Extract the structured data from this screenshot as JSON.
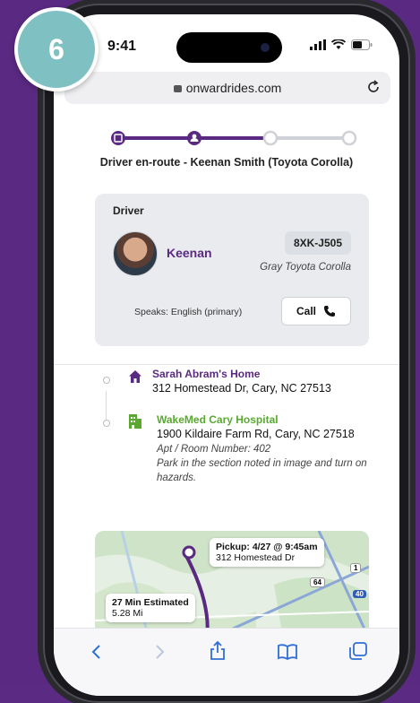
{
  "status_bar": {
    "time": "9:41"
  },
  "browser": {
    "url": "onwardrides.com"
  },
  "step_badge": {
    "number": "6"
  },
  "progress": {
    "steps": 4,
    "completed": 2
  },
  "status_text": "Driver en-route - Keenan Smith (Toyota Corolla)",
  "driver_card": {
    "title": "Driver",
    "name": "Keenan",
    "plate": "8XK-J505",
    "car": "Gray Toyota Corolla",
    "speaks": "Speaks: English (primary)",
    "call_label": "Call"
  },
  "pickup": {
    "name": "Sarah Abram's Home",
    "address": "312 Homestead Dr, Cary, NC 27513"
  },
  "dropoff": {
    "name": "WakeMed Cary Hospital",
    "address": "1900 Kildaire Farm Rd, Cary, NC 27518",
    "apt": "Apt / Room Number: 402",
    "note": "Park in the section noted in image and turn on hazards."
  },
  "map": {
    "pickup_label": "Pickup: 4/27 @ 9:45am",
    "pickup_address": "312 Homestead Dr",
    "estimate": "27 Min Estimated",
    "distance": "5.28 Mi",
    "route_1": "1",
    "route_64": "64",
    "route_40": "40"
  },
  "colors": {
    "brand": "#5a2a82",
    "green": "#5aa832",
    "badge": "#7fc1c3"
  }
}
